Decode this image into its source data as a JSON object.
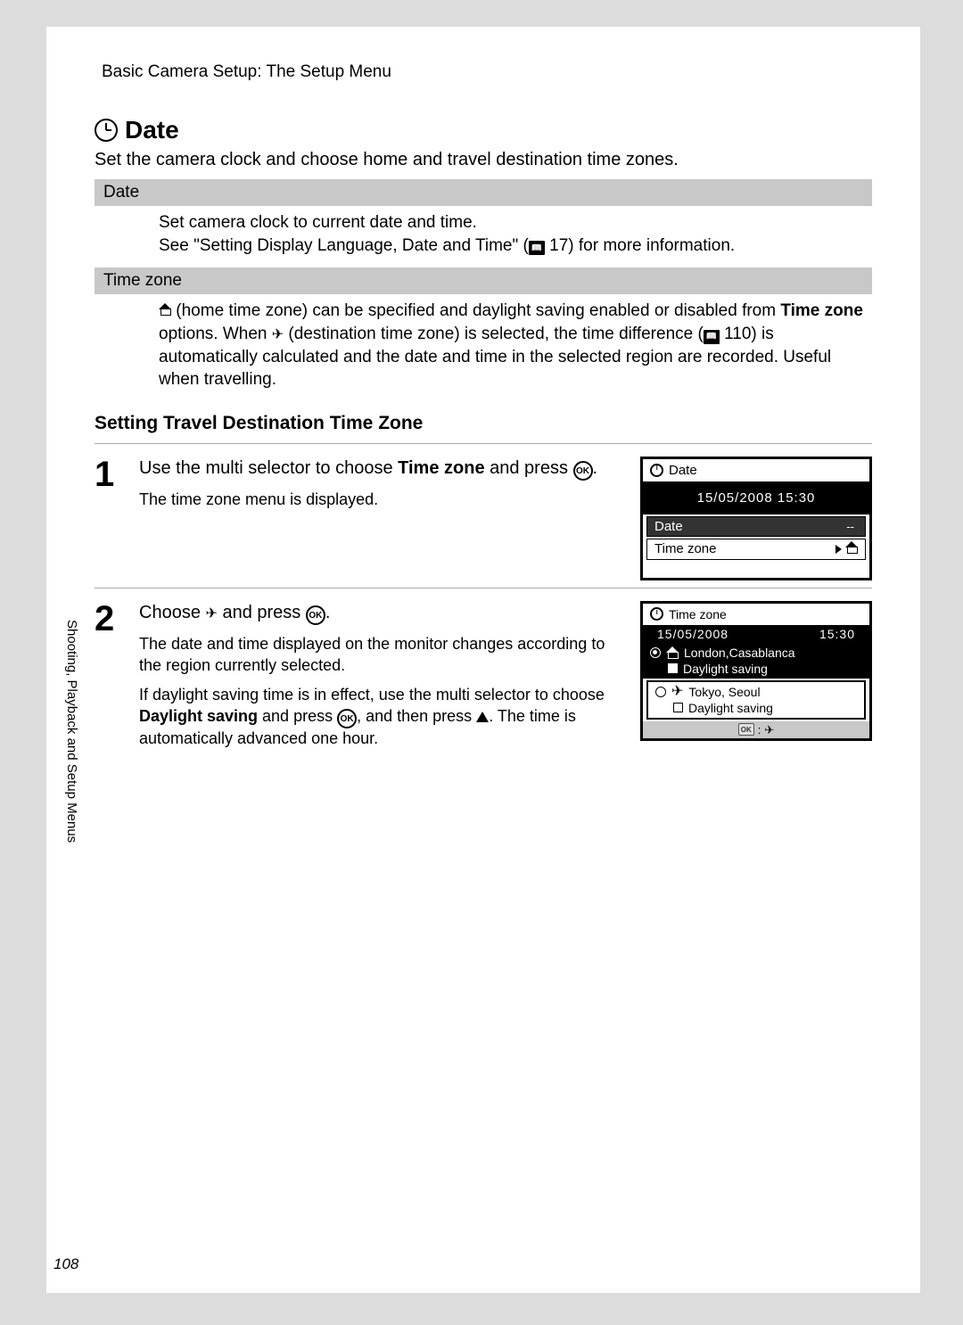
{
  "header": "Basic Camera Setup: The Setup Menu",
  "title": "Date",
  "intro": "Set the camera clock and choose home and travel destination time zones.",
  "table": {
    "row1_label": "Date",
    "row1_body_line1": "Set camera clock to current date and time.",
    "row1_body_line2a": "See \"Setting Display Language, Date and Time\" (",
    "row1_body_line2b": " 17) for more information.",
    "row2_label": "Time zone",
    "row2_body_a": " (home time zone) can be specified and daylight saving enabled or disabled from ",
    "row2_body_b": "Time zone",
    "row2_body_c": " options. When ",
    "row2_body_d": " (destination time zone) is selected, the time difference (",
    "row2_body_e": " 110) is automatically calculated and the date and time in the selected region are recorded. Useful when travelling."
  },
  "subheading": "Setting Travel Destination Time Zone",
  "step1": {
    "num": "1",
    "line_a": "Use the multi selector to choose ",
    "line_b": "Time zone",
    "line_c": " and press ",
    "small": "The time zone menu is displayed.",
    "lcd_title": "Date",
    "lcd_datetime": "15/05/2008 15:30",
    "lcd_date": "Date",
    "lcd_dash": "--",
    "lcd_tz": "Time zone"
  },
  "step2": {
    "num": "2",
    "line_a": "Choose ",
    "line_b": " and press ",
    "small1": "The date and time displayed on the monitor changes according to the region currently selected.",
    "small2_a": "If daylight saving time is in effect, use the multi selector to choose ",
    "small2_b": "Daylight saving",
    "small2_c": " and press ",
    "small2_d": ", and then press ",
    "small2_e": ". The time is automatically advanced one hour.",
    "lcd_title": "Time zone",
    "lcd_date": "15/05/2008",
    "lcd_time": "15:30",
    "tz_home": "London,Casablanca",
    "tz_home_ds": "Daylight saving",
    "tz_dest": "Tokyo, Seoul",
    "tz_dest_ds": "Daylight saving",
    "ok_label": "OK"
  },
  "side_text": "Shooting, Playback and Setup Menus",
  "page_num": "108"
}
